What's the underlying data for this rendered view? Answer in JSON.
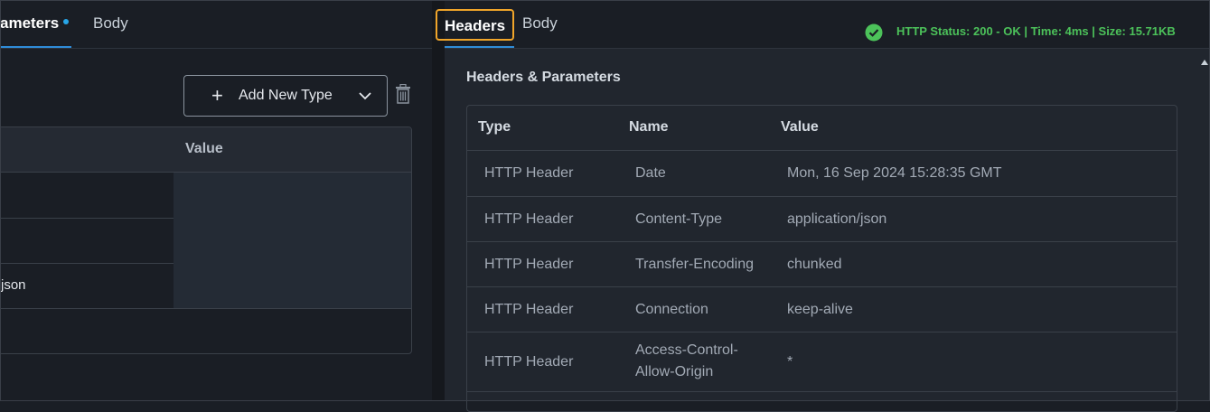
{
  "left_pane": {
    "tabs": [
      {
        "label": "ameters"
      },
      {
        "label": "Body"
      }
    ],
    "add_type_button": {
      "label": "Add New Type"
    },
    "table": {
      "value_header": "Value",
      "rows": [
        {
          "key": "",
          "value": ""
        },
        {
          "key": "",
          "value": ""
        },
        {
          "key": "json",
          "value": ""
        }
      ]
    }
  },
  "right_pane": {
    "tabs": [
      {
        "label": "Headers"
      },
      {
        "label": "Body"
      }
    ],
    "status": {
      "text": "HTTP Status: 200 - OK | Time: 4ms | Size: 15.71KB",
      "color": "#4cc25a"
    },
    "panel_title": "Headers & Parameters",
    "table": {
      "columns": [
        "Type",
        "Name",
        "Value"
      ],
      "rows": [
        {
          "type": "HTTP Header",
          "name": "Date",
          "value": "Mon, 16 Sep 2024 15:28:35 GMT"
        },
        {
          "type": "HTTP Header",
          "name": "Content-Type",
          "value": "application/json"
        },
        {
          "type": "HTTP Header",
          "name": "Transfer-Encoding",
          "value": "chunked"
        },
        {
          "type": "HTTP Header",
          "name": "Connection",
          "value": "keep-alive"
        },
        {
          "type": "HTTP Header",
          "name": "Access-Control-Allow-Origin",
          "value": "*"
        }
      ]
    }
  },
  "icons": [
    "plus-icon",
    "chevron-down-icon",
    "trash-icon",
    "check-circle-icon",
    "scroll-up-arrow-icon"
  ],
  "colors": {
    "accent_tab": "#2f8cd8",
    "focus_outline": "#f0a52a",
    "status_ok": "#4cc25a"
  }
}
